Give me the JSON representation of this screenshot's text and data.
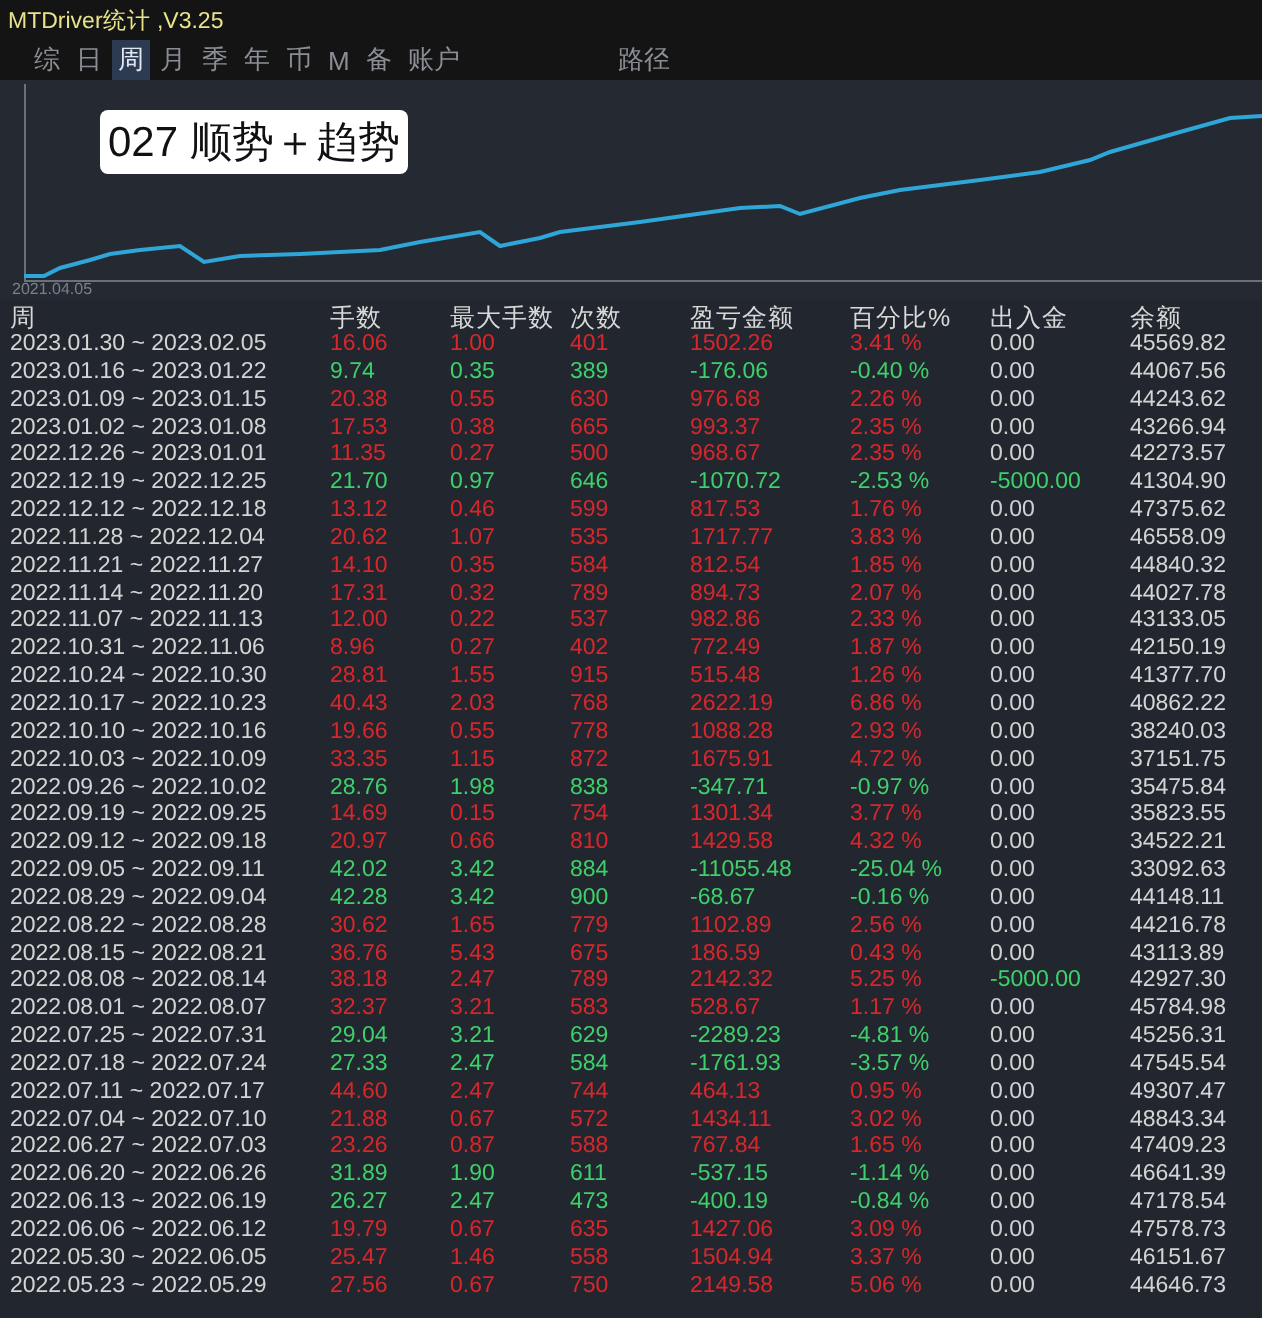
{
  "window": {
    "title": "MTDriver统计 ,V3.25"
  },
  "tabs": [
    {
      "label": "综",
      "selected": false
    },
    {
      "label": "日",
      "selected": false
    },
    {
      "label": "周",
      "selected": true
    },
    {
      "label": "月",
      "selected": false
    },
    {
      "label": "季",
      "selected": false
    },
    {
      "label": "年",
      "selected": false
    },
    {
      "label": "币",
      "selected": false
    },
    {
      "label": "M",
      "selected": false
    },
    {
      "label": "备",
      "selected": false
    },
    {
      "label": "账户",
      "selected": false
    }
  ],
  "path_label": "路径",
  "chart": {
    "caption": "027 顺势＋趋势",
    "start_date": "2021.04.05"
  },
  "table": {
    "columns": [
      "周",
      "手数",
      "最大手数",
      "次数",
      "盈亏金额",
      "百分比%",
      "出入金",
      "余额"
    ],
    "rows": [
      {
        "kind": "gain",
        "cells": [
          "2023.01.30 ~ 2023.02.05",
          "16.06",
          "1.00",
          "401",
          "1502.26",
          "3.41 %",
          "0.00",
          "45569.82"
        ]
      },
      {
        "kind": "loss",
        "cells": [
          "2023.01.16 ~ 2023.01.22",
          "9.74",
          "0.35",
          "389",
          "-176.06",
          "-0.40 %",
          "0.00",
          "44067.56"
        ]
      },
      {
        "kind": "gain",
        "cells": [
          "2023.01.09 ~ 2023.01.15",
          "20.38",
          "0.55",
          "630",
          "976.68",
          "2.26 %",
          "0.00",
          "44243.62"
        ]
      },
      {
        "kind": "gain",
        "cells": [
          "2023.01.02 ~ 2023.01.08",
          "17.53",
          "0.38",
          "665",
          "993.37",
          "2.35 %",
          "0.00",
          "43266.94"
        ]
      },
      {
        "kind": "gain",
        "cells": [
          "2022.12.26 ~ 2023.01.01",
          "11.35",
          "0.27",
          "500",
          "968.67",
          "2.35 %",
          "0.00",
          "42273.57"
        ]
      },
      {
        "kind": "loss",
        "transfer": true,
        "cells": [
          "2022.12.19 ~ 2022.12.25",
          "21.70",
          "0.97",
          "646",
          "-1070.72",
          "-2.53 %",
          "-5000.00",
          "41304.90"
        ]
      },
      {
        "kind": "gain",
        "cells": [
          "2022.12.12 ~ 2022.12.18",
          "13.12",
          "0.46",
          "599",
          "817.53",
          "1.76 %",
          "0.00",
          "47375.62"
        ]
      },
      {
        "kind": "gain",
        "cells": [
          "2022.11.28 ~ 2022.12.04",
          "20.62",
          "1.07",
          "535",
          "1717.77",
          "3.83 %",
          "0.00",
          "46558.09"
        ]
      },
      {
        "kind": "gain",
        "cells": [
          "2022.11.21 ~ 2022.11.27",
          "14.10",
          "0.35",
          "584",
          "812.54",
          "1.85 %",
          "0.00",
          "44840.32"
        ]
      },
      {
        "kind": "gain",
        "cells": [
          "2022.11.14 ~ 2022.11.20",
          "17.31",
          "0.32",
          "789",
          "894.73",
          "2.07 %",
          "0.00",
          "44027.78"
        ]
      },
      {
        "kind": "gain",
        "cells": [
          "2022.11.07 ~ 2022.11.13",
          "12.00",
          "0.22",
          "537",
          "982.86",
          "2.33 %",
          "0.00",
          "43133.05"
        ]
      },
      {
        "kind": "gain",
        "cells": [
          "2022.10.31 ~ 2022.11.06",
          "8.96",
          "0.27",
          "402",
          "772.49",
          "1.87 %",
          "0.00",
          "42150.19"
        ]
      },
      {
        "kind": "gain",
        "cells": [
          "2022.10.24 ~ 2022.10.30",
          "28.81",
          "1.55",
          "915",
          "515.48",
          "1.26 %",
          "0.00",
          "41377.70"
        ]
      },
      {
        "kind": "gain",
        "cells": [
          "2022.10.17 ~ 2022.10.23",
          "40.43",
          "2.03",
          "768",
          "2622.19",
          "6.86 %",
          "0.00",
          "40862.22"
        ]
      },
      {
        "kind": "gain",
        "cells": [
          "2022.10.10 ~ 2022.10.16",
          "19.66",
          "0.55",
          "778",
          "1088.28",
          "2.93 %",
          "0.00",
          "38240.03"
        ]
      },
      {
        "kind": "gain",
        "cells": [
          "2022.10.03 ~ 2022.10.09",
          "33.35",
          "1.15",
          "872",
          "1675.91",
          "4.72 %",
          "0.00",
          "37151.75"
        ]
      },
      {
        "kind": "loss",
        "cells": [
          "2022.09.26 ~ 2022.10.02",
          "28.76",
          "1.98",
          "838",
          "-347.71",
          "-0.97 %",
          "0.00",
          "35475.84"
        ]
      },
      {
        "kind": "gain",
        "cells": [
          "2022.09.19 ~ 2022.09.25",
          "14.69",
          "0.15",
          "754",
          "1301.34",
          "3.77 %",
          "0.00",
          "35823.55"
        ]
      },
      {
        "kind": "gain",
        "cells": [
          "2022.09.12 ~ 2022.09.18",
          "20.97",
          "0.66",
          "810",
          "1429.58",
          "4.32 %",
          "0.00",
          "34522.21"
        ]
      },
      {
        "kind": "loss",
        "cells": [
          "2022.09.05 ~ 2022.09.11",
          "42.02",
          "3.42",
          "884",
          "-11055.48",
          "-25.04 %",
          "0.00",
          "33092.63"
        ]
      },
      {
        "kind": "loss",
        "cells": [
          "2022.08.29 ~ 2022.09.04",
          "42.28",
          "3.42",
          "900",
          "-68.67",
          "-0.16 %",
          "0.00",
          "44148.11"
        ]
      },
      {
        "kind": "gain",
        "cells": [
          "2022.08.22 ~ 2022.08.28",
          "30.62",
          "1.65",
          "779",
          "1102.89",
          "2.56 %",
          "0.00",
          "44216.78"
        ]
      },
      {
        "kind": "gain",
        "cells": [
          "2022.08.15 ~ 2022.08.21",
          "36.76",
          "5.43",
          "675",
          "186.59",
          "0.43 %",
          "0.00",
          "43113.89"
        ]
      },
      {
        "kind": "gain",
        "transfer": true,
        "cells": [
          "2022.08.08 ~ 2022.08.14",
          "38.18",
          "2.47",
          "789",
          "2142.32",
          "5.25 %",
          "-5000.00",
          "42927.30"
        ]
      },
      {
        "kind": "gain",
        "cells": [
          "2022.08.01 ~ 2022.08.07",
          "32.37",
          "3.21",
          "583",
          "528.67",
          "1.17 %",
          "0.00",
          "45784.98"
        ]
      },
      {
        "kind": "loss",
        "cells": [
          "2022.07.25 ~ 2022.07.31",
          "29.04",
          "3.21",
          "629",
          "-2289.23",
          "-4.81 %",
          "0.00",
          "45256.31"
        ]
      },
      {
        "kind": "loss",
        "cells": [
          "2022.07.18 ~ 2022.07.24",
          "27.33",
          "2.47",
          "584",
          "-1761.93",
          "-3.57 %",
          "0.00",
          "47545.54"
        ]
      },
      {
        "kind": "gain",
        "cells": [
          "2022.07.11 ~ 2022.07.17",
          "44.60",
          "2.47",
          "744",
          "464.13",
          "0.95 %",
          "0.00",
          "49307.47"
        ]
      },
      {
        "kind": "gain",
        "cells": [
          "2022.07.04 ~ 2022.07.10",
          "21.88",
          "0.67",
          "572",
          "1434.11",
          "3.02 %",
          "0.00",
          "48843.34"
        ]
      },
      {
        "kind": "gain",
        "cells": [
          "2022.06.27 ~ 2022.07.03",
          "23.26",
          "0.87",
          "588",
          "767.84",
          "1.65 %",
          "0.00",
          "47409.23"
        ]
      },
      {
        "kind": "loss",
        "cells": [
          "2022.06.20 ~ 2022.06.26",
          "31.89",
          "1.90",
          "611",
          "-537.15",
          "-1.14 %",
          "0.00",
          "46641.39"
        ]
      },
      {
        "kind": "loss",
        "cells": [
          "2022.06.13 ~ 2022.06.19",
          "26.27",
          "2.47",
          "473",
          "-400.19",
          "-0.84 %",
          "0.00",
          "47178.54"
        ]
      },
      {
        "kind": "gain",
        "cells": [
          "2022.06.06 ~ 2022.06.12",
          "19.79",
          "0.67",
          "635",
          "1427.06",
          "3.09 %",
          "0.00",
          "47578.73"
        ]
      },
      {
        "kind": "gain",
        "cells": [
          "2022.05.30 ~ 2022.06.05",
          "25.47",
          "1.46",
          "558",
          "1504.94",
          "3.37 %",
          "0.00",
          "46151.67"
        ]
      },
      {
        "kind": "gain",
        "cells": [
          "2022.05.23 ~ 2022.05.29",
          "27.56",
          "0.67",
          "750",
          "2149.58",
          "5.06 %",
          "0.00",
          "44646.73"
        ]
      }
    ]
  }
}
